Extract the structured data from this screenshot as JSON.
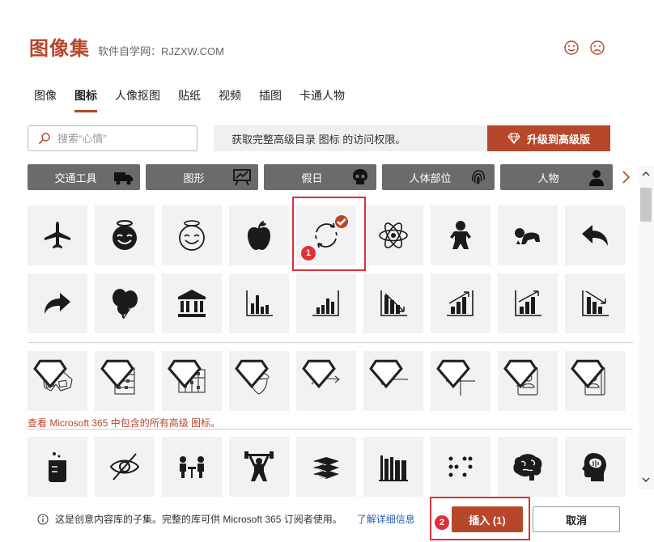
{
  "dialog": {
    "title": "图像集",
    "subtitle": "软件自学网：RJZXW.COM"
  },
  "tabs": [
    "图像",
    "图标",
    "人像抠图",
    "贴纸",
    "视频",
    "插图",
    "卡通人物"
  ],
  "active_tab": "图标",
  "search": {
    "placeholder": "搜索“心情”"
  },
  "notice": {
    "text": "获取完整高级目录 图标 的访问权限。"
  },
  "upgrade_button": {
    "label": "升级到高级版"
  },
  "categories": [
    {
      "label": "交通工具",
      "icon": "truck-icon"
    },
    {
      "label": "图形",
      "icon": "chart-board-icon"
    },
    {
      "label": "假日",
      "icon": "skull-icon"
    },
    {
      "label": "人体部位",
      "icon": "fingerprint-icon"
    },
    {
      "label": "人物",
      "icon": "person-icon"
    }
  ],
  "icon_rows": {
    "row1": [
      "airplane-icon",
      "angel-face-filled-icon",
      "angel-face-outline-icon",
      "apple-icon",
      "refresh-cycle-icon",
      "atom-icon",
      "baby-icon",
      "crawling-baby-icon",
      "reply-arrow-icon"
    ],
    "row2": [
      "forward-arrow-icon",
      "balloons-icon",
      "bank-icon",
      "bar-chart-icon",
      "bar-chart-upward-icon",
      "bar-chart-down-icon",
      "bar-chart-up-icon",
      "bar-chart-up-arrow-icon",
      "bar-chart-down-arrow-icon"
    ],
    "premium_row": [
      "3d-glasses-icon",
      "abacus-icon",
      "abacus-alt-icon",
      "acorn-icon",
      "curved-right-arrow-icon",
      "curved-left-arrow-icon",
      "add-plus-icon",
      "address-book-icon",
      "address-book-alt-icon"
    ],
    "row4": [
      "beaker-icon",
      "hidden-eye-icon",
      "meeting-icon",
      "weightlifter-icon",
      "books-stack-icon",
      "bookshelf-icon",
      "braille-icon",
      "brain-icon",
      "head-brain-icon"
    ]
  },
  "selected_icon": "refresh-cycle-icon",
  "premium_link": "查看 Microsoft 365 中包含的所有高级 图标。",
  "footer": {
    "info": "这是创意内容库的子集。完整的库可供 Microsoft 365 订阅者使用。",
    "learn_more": "了解详细信息"
  },
  "insert_button": {
    "label": "插入 (1)"
  },
  "cancel_button": {
    "label": "取消"
  },
  "annotations": {
    "badge1": "1",
    "badge2": "2"
  },
  "colors": {
    "accent": "#b7472a",
    "category_bg": "#6b6b6b",
    "tile_bg": "#f2f2f2",
    "highlight": "#e0303a",
    "link": "#2a5db0"
  }
}
